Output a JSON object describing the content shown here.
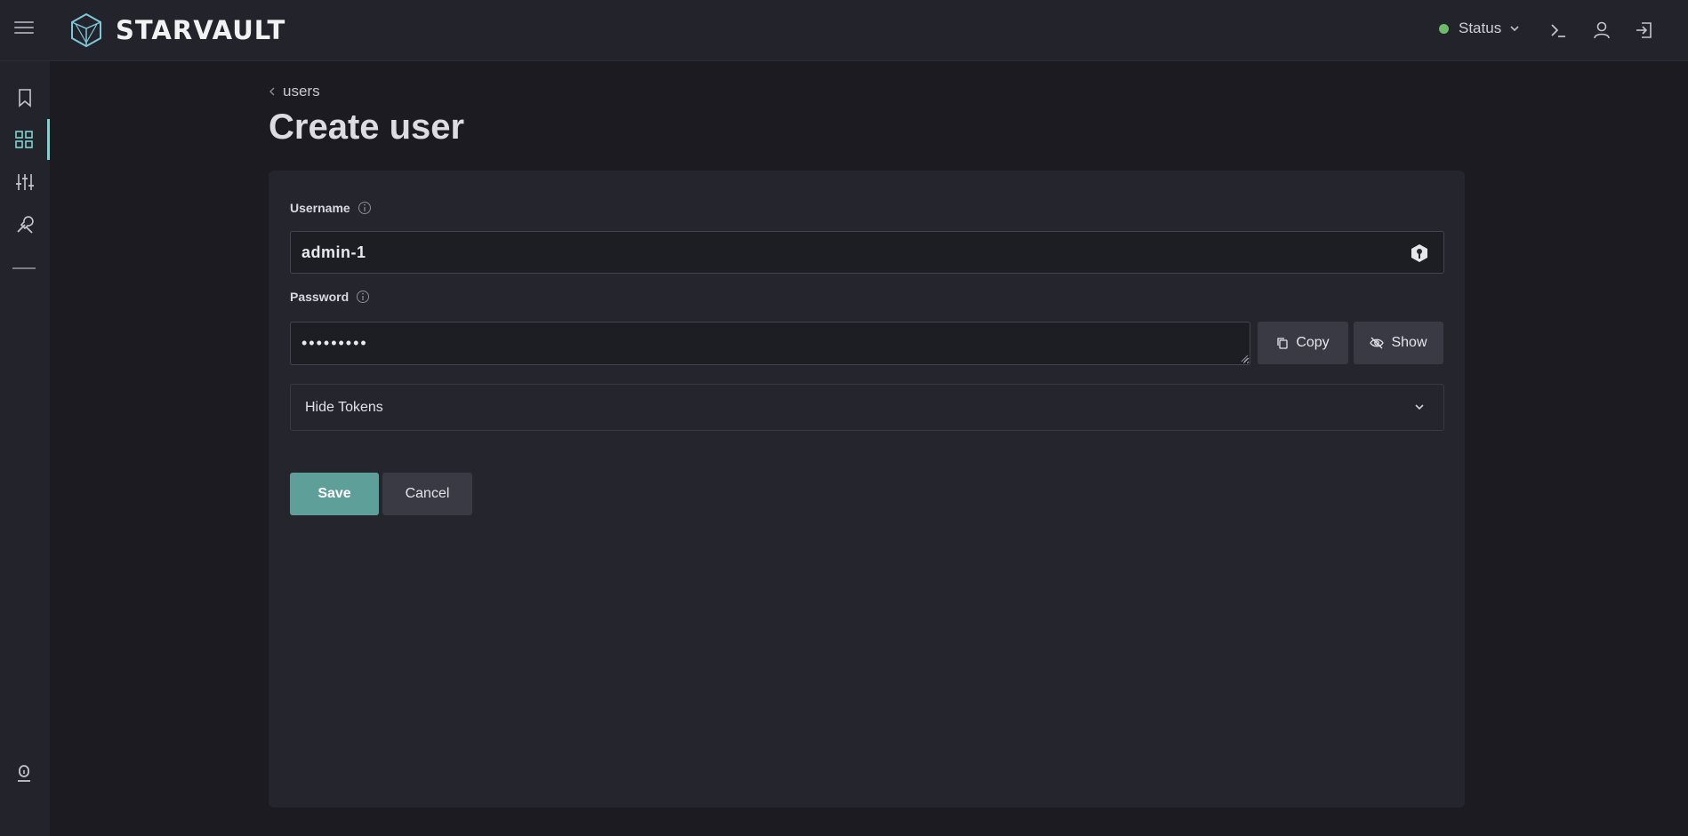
{
  "app": {
    "brand": "STARVAULT"
  },
  "topbar": {
    "status_label": "Status",
    "status_color": "#6dbb6a",
    "icons": [
      "terminal-icon",
      "user-icon",
      "sign-out-icon"
    ]
  },
  "sidebar": {
    "items": [
      {
        "icon": "bookmark-icon"
      },
      {
        "icon": "grid-icon",
        "active": true
      },
      {
        "icon": "sliders-icon"
      },
      {
        "icon": "tools-icon"
      }
    ],
    "footer_icon": "pin-icon"
  },
  "breadcrumb": {
    "label": "users"
  },
  "page": {
    "title": "Create user"
  },
  "form": {
    "username": {
      "label": "Username",
      "value": "admin-1"
    },
    "password": {
      "label": "Password",
      "value": "•••••••••"
    },
    "copy_label": "Copy",
    "show_label": "Show",
    "accordion_label": "Hide Tokens",
    "save_label": "Save",
    "cancel_label": "Cancel"
  },
  "colors": {
    "accent": "#7ed3d1",
    "primary_button": "#5e9f9a"
  }
}
